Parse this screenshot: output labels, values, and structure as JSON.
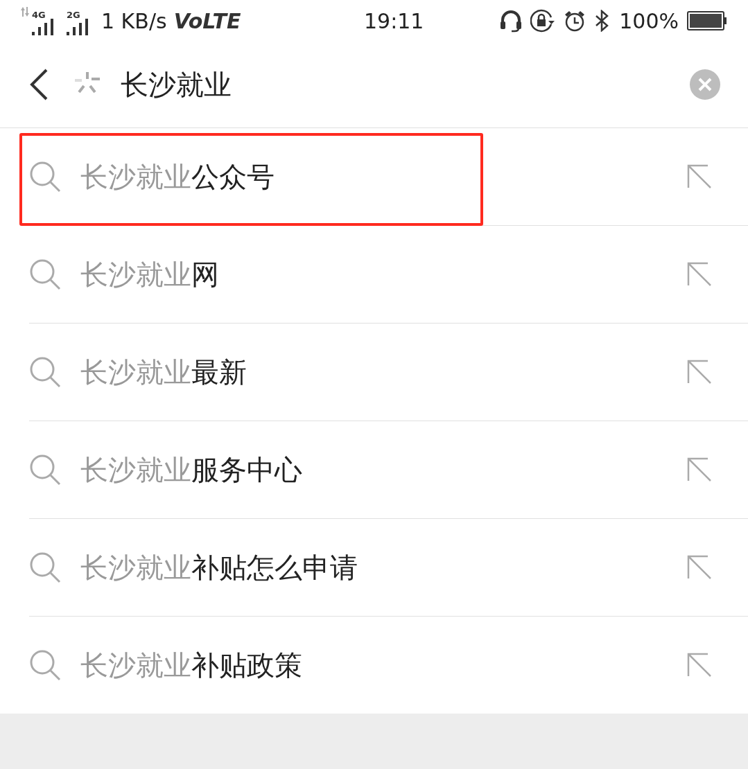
{
  "status_bar": {
    "net_4g": "4G",
    "net_2g": "2G",
    "speed": "1 KB/s",
    "volte": "VoLTE",
    "time": "19:11",
    "battery": "100%"
  },
  "search": {
    "value": "长沙就业"
  },
  "suggestions": [
    {
      "prefix": "长沙就业",
      "suffix": "公众号",
      "highlighted": true
    },
    {
      "prefix": "长沙就业",
      "suffix": "网",
      "highlighted": false
    },
    {
      "prefix": "长沙就业",
      "suffix": "最新",
      "highlighted": false
    },
    {
      "prefix": "长沙就业",
      "suffix": "服务中心",
      "highlighted": false
    },
    {
      "prefix": "长沙就业",
      "suffix": "补贴怎么申请",
      "highlighted": false
    },
    {
      "prefix": "长沙就业",
      "suffix": "补贴政策",
      "highlighted": false
    }
  ]
}
